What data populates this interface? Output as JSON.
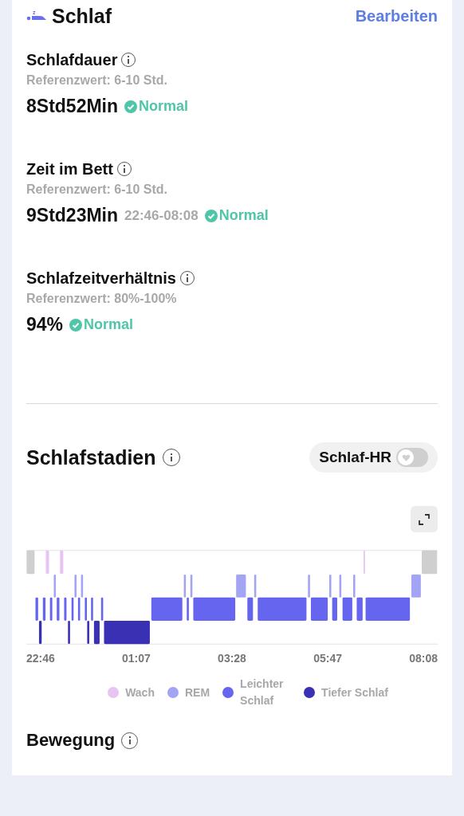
{
  "header": {
    "title": "Schlaf",
    "edit_link": "Bearbeiten"
  },
  "metrics": [
    {
      "title": "Schlafdauer",
      "reference": "Referenzwert: 6-10 Std.",
      "value": "8Std52Min",
      "status": "Normal"
    },
    {
      "title": "Zeit im Bett",
      "reference": "Referenzwert: 6-10 Std.",
      "value": "9Std23Min",
      "range": "22:46-08:08",
      "status": "Normal"
    },
    {
      "title": "Schlafzeitverhältnis",
      "reference": "Referenzwert: 80%-100%",
      "value": "94%",
      "status": "Normal"
    }
  ],
  "sleep_stages": {
    "title": "Schlafstadien",
    "hr_toggle": {
      "label": "Schlaf-HR",
      "on": false
    },
    "time_ticks": [
      "22:46",
      "01:07",
      "03:28",
      "05:47",
      "08:08"
    ],
    "legend": [
      {
        "label": "Wach",
        "color": "#e8c4f3"
      },
      {
        "label": "REM",
        "color": "#a4a4f4"
      },
      {
        "label": "Leichter Schlaf",
        "color": "#6565f0"
      },
      {
        "label": "Tiefer Schlaf",
        "color": "#3a30b4"
      }
    ]
  },
  "next_section": {
    "title": "Bewegung"
  }
}
